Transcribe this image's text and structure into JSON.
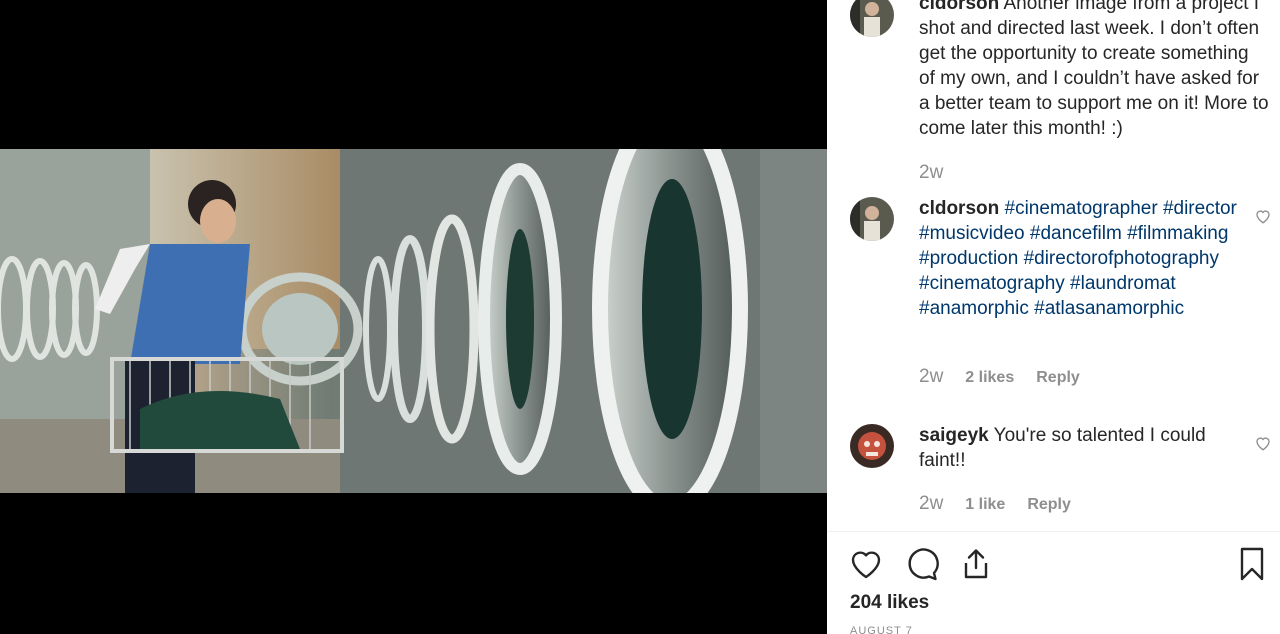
{
  "post": {
    "caption": {
      "username": "cldorson",
      "text": "Another image from a project I shot and directed last week. I don’t often get the opportunity to create something of my own, and I couldn’t have asked for a better team to support me on it! More to come later this month! :)",
      "time": "2w"
    },
    "comments": [
      {
        "username": "cldorson",
        "hashtags": [
          "#cinematographer",
          "#director",
          "#musicvideo",
          "#dancefilm",
          "#filmmaking",
          "#production",
          "#directorofphotography",
          "#cinematography",
          "#laundromat",
          "#anamorphic",
          "#atlasanamorphic"
        ],
        "time": "2w",
        "likes": "2 likes",
        "reply": "Reply"
      },
      {
        "username": "saigeyk",
        "text": "You're so talented I could faint!!",
        "time": "2w",
        "likes": "1 like",
        "reply": "Reply"
      }
    ],
    "likes_total": "204 likes",
    "date": "AUGUST 7"
  },
  "icons": {
    "like": "heart-icon",
    "comment": "speech-bubble-icon",
    "share": "share-icon",
    "save": "bookmark-icon",
    "comment_like": "heart-outline-icon"
  },
  "colors": {
    "text": "#262626",
    "hashtag": "#00376b",
    "muted": "#8e8e8e",
    "background": "#000000"
  }
}
